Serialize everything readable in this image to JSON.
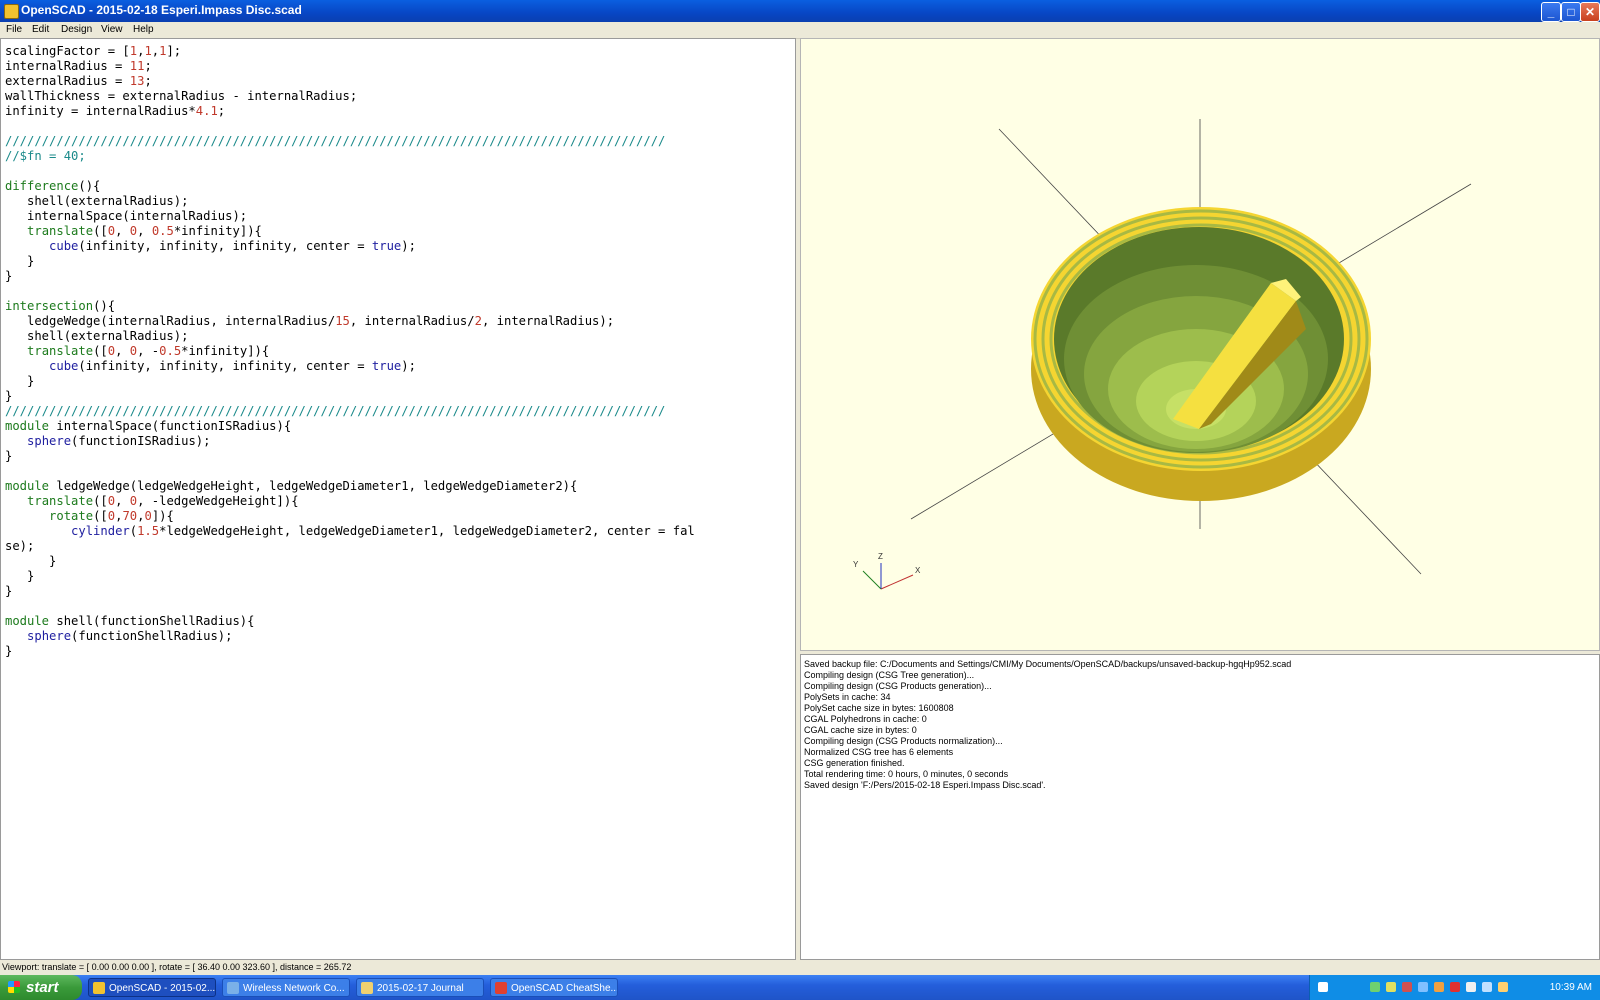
{
  "window": {
    "title": "OpenSCAD - 2015-02-18 Esperi.Impass Disc.scad"
  },
  "menu": [
    "File",
    "Edit",
    "Design",
    "View",
    "Help"
  ],
  "editor": {
    "code_lines": [
      "scalingFactor = [1,1,1];",
      "internalRadius = 11;",
      "externalRadius = 13;",
      "wallThickness = externalRadius - internalRadius;",
      "infinity = internalRadius*4.1;",
      "",
      "//////////////////////////////////////////////////////////////////////////////////////////",
      "//$fn = 40;",
      "",
      "difference(){",
      "   shell(externalRadius);",
      "   internalSpace(internalRadius);",
      "   translate([0, 0, 0.5*infinity]){",
      "      cube(infinity, infinity, infinity, center = true);",
      "   }",
      "}",
      "",
      "intersection(){",
      "   ledgeWedge(internalRadius, internalRadius/15, internalRadius/2, internalRadius);",
      "   shell(externalRadius);",
      "   translate([0, 0, -0.5*infinity]){",
      "      cube(infinity, infinity, infinity, center = true);",
      "   }",
      "}",
      "//////////////////////////////////////////////////////////////////////////////////////////",
      "module internalSpace(functionISRadius){",
      "   sphere(functionISRadius);",
      "}",
      "",
      "module ledgeWedge(ledgeWedgeHeight, ledgeWedgeDiameter1, ledgeWedgeDiameter2){",
      "   translate([0, 0, -ledgeWedgeHeight]){",
      "      rotate([0,70,0]){",
      "         cylinder(1.5*ledgeWedgeHeight, ledgeWedgeDiameter1, ledgeWedgeDiameter2, center = fal",
      "se);",
      "      }",
      "   }",
      "}",
      "",
      "module shell(functionShellRadius){",
      "   sphere(functionShellRadius);",
      "}"
    ]
  },
  "viewport": {
    "axes_labels": {
      "x": "X",
      "y": "Y",
      "z": "Z"
    },
    "colors": {
      "background": "#ffffe5",
      "model": "#f5d531",
      "inner": "#8fb04a"
    }
  },
  "console": {
    "lines": [
      "Saved backup file: C:/Documents and Settings/CMI/My Documents/OpenSCAD/backups/unsaved-backup-hgqHp952.scad",
      "Compiling design (CSG Tree generation)...",
      "Compiling design (CSG Products generation)...",
      "PolySets in cache: 34",
      "PolySet cache size in bytes: 1600808",
      "CGAL Polyhedrons in cache: 0",
      "CGAL cache size in bytes: 0",
      "Compiling design (CSG Products normalization)...",
      "Normalized CSG tree has 6 elements",
      "CSG generation finished.",
      "Total rendering time: 0 hours, 0 minutes, 0 seconds",
      "Saved design 'F:/Pers/2015-02-18 Esperi.Impass Disc.scad'."
    ]
  },
  "statusbar": {
    "text": "Viewport: translate = [ 0.00 0.00 0.00 ], rotate = [ 36.40 0.00 323.60 ], distance = 265.72"
  },
  "taskbar": {
    "start": "start",
    "tasks": [
      {
        "label": "OpenSCAD - 2015-02...",
        "icon_color": "#f2c230",
        "active": true
      },
      {
        "label": "Wireless Network Co...",
        "icon_color": "#7ab0e8",
        "active": false
      },
      {
        "label": "2015-02-17 Journal",
        "icon_color": "#f0d070",
        "active": false
      },
      {
        "label": "OpenSCAD CheatShe...",
        "icon_color": "#e04030",
        "active": false
      }
    ],
    "clock": "10:39 AM"
  }
}
